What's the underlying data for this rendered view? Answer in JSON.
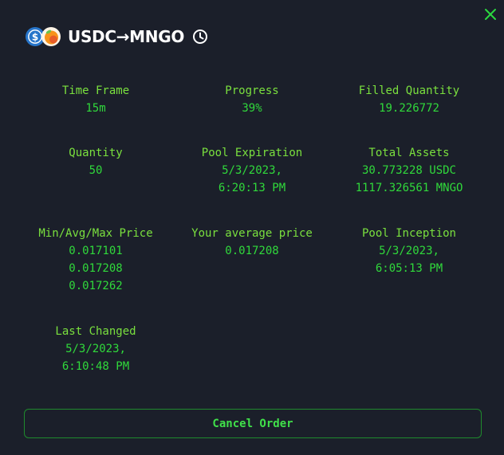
{
  "colors": {
    "background": "#1b1f2a",
    "accent_green": "#30d93b",
    "close_green": "#2bd940",
    "button_border": "#1f8a2d",
    "usdc_blue": "#2775ca",
    "mngo_orange": "#f7931a"
  },
  "header": {
    "pair": "USDC→MNGO",
    "base_icon": "usdc-token-icon",
    "quote_icon": "mngo-token-icon",
    "clock_icon": "clock-icon",
    "close_icon": "close-icon"
  },
  "stats": {
    "time_frame": {
      "label": "Time Frame",
      "value": "15m"
    },
    "progress": {
      "label": "Progress",
      "value": "39%"
    },
    "filled_quantity": {
      "label": "Filled Quantity",
      "value": "19.226772"
    },
    "quantity": {
      "label": "Quantity",
      "value": "50"
    },
    "pool_expiration": {
      "label": "Pool Expiration",
      "value_line1": "5/3/2023,",
      "value_line2": "6:20:13 PM"
    },
    "total_assets": {
      "label": "Total Assets",
      "value_line1": "30.773228 USDC",
      "value_line2": "1117.326561 MNGO"
    },
    "min_avg_max_price": {
      "label": "Min/Avg/Max Price",
      "min": "0.017101",
      "avg": "0.017208",
      "max": "0.017262"
    },
    "your_average_price": {
      "label": "Your average price",
      "value": "0.017208"
    },
    "pool_inception": {
      "label": "Pool Inception",
      "value_line1": "5/3/2023,",
      "value_line2": "6:05:13 PM"
    },
    "last_changed": {
      "label": "Last Changed",
      "value_line1": "5/3/2023,",
      "value_line2": "6:10:48 PM"
    }
  },
  "actions": {
    "cancel_label": "Cancel Order"
  }
}
